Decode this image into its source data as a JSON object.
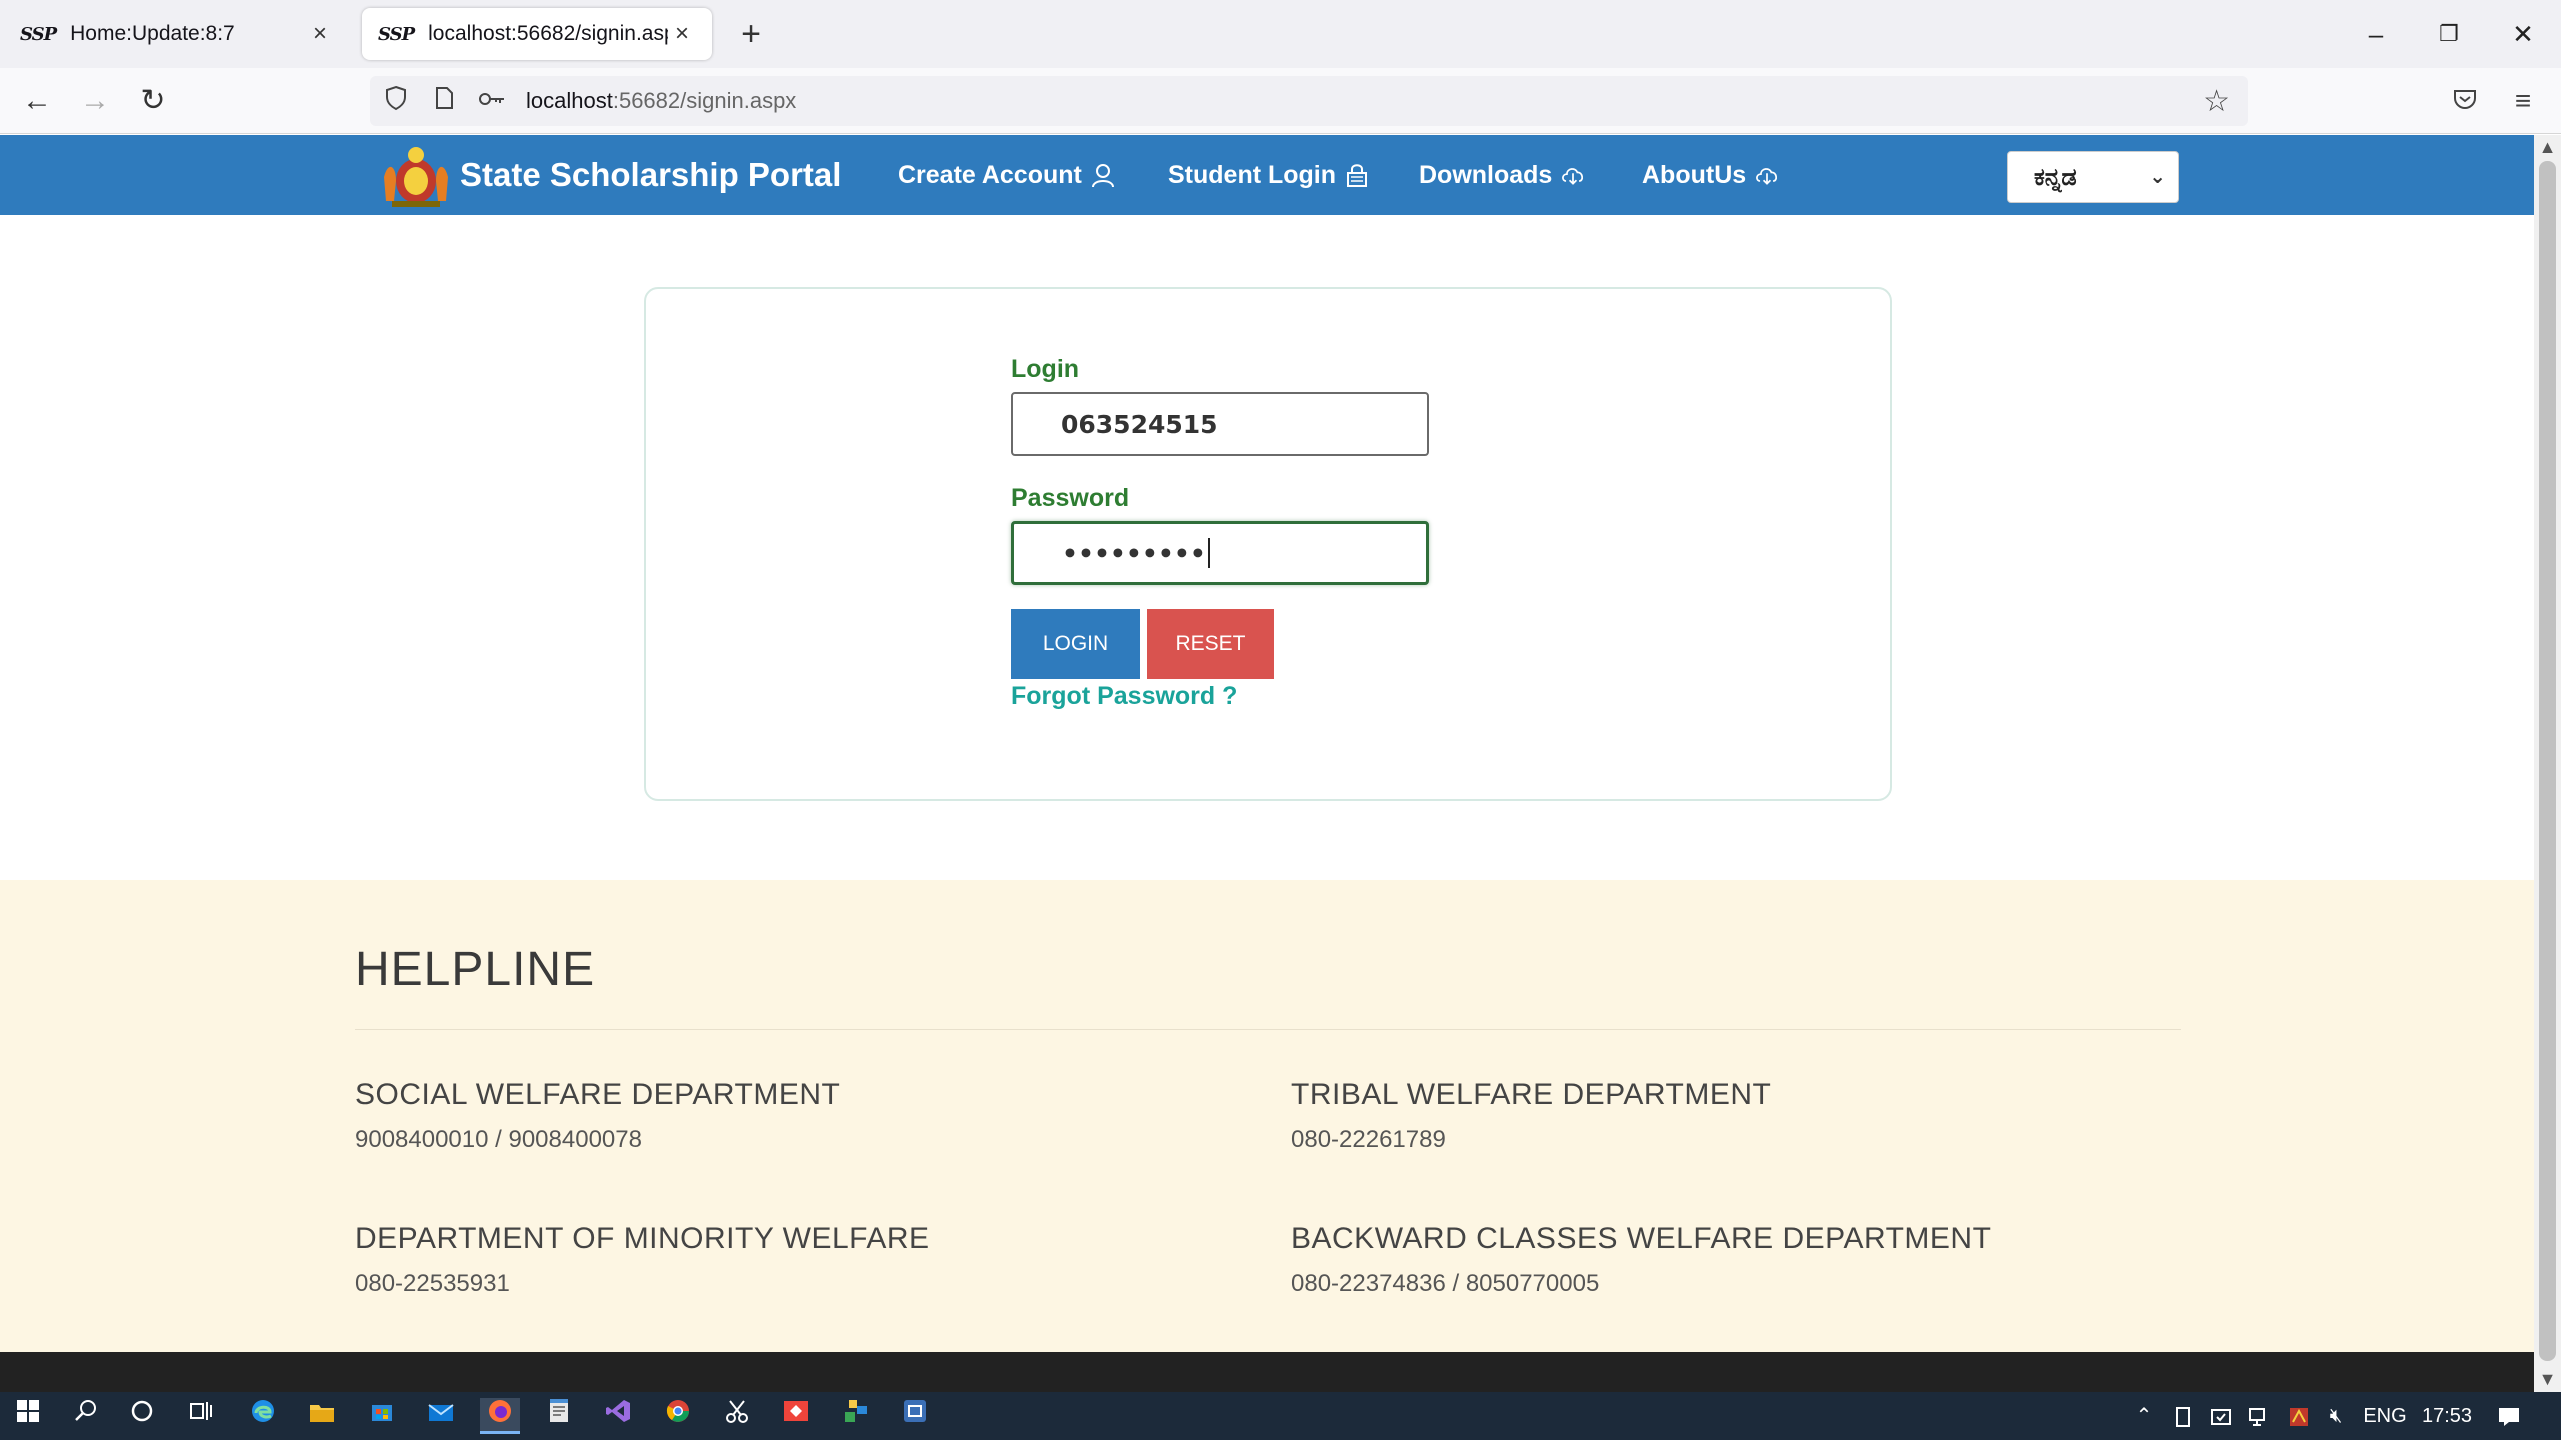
{
  "browser": {
    "tabs": [
      {
        "favicon": "SSP",
        "title": "Home:Update:8:7",
        "active": false
      },
      {
        "favicon": "SSP",
        "title": "localhost:56682/signin.aspx",
        "active": true
      }
    ],
    "url_host": "localhost",
    "url_path": ":56682/signin.aspx"
  },
  "header": {
    "brand": "State Scholarship Portal",
    "menu": [
      {
        "label": "Create Account",
        "icon": "user-icon"
      },
      {
        "label": "Student Login",
        "icon": "lock-icon"
      },
      {
        "label": "Downloads",
        "icon": "cloud-download-icon"
      },
      {
        "label": "AboutUs",
        "icon": "cloud-download-icon"
      }
    ],
    "language": "ಕನ್ನಡ"
  },
  "login": {
    "login_label": "Login",
    "login_value": "063524515",
    "password_label": "Password",
    "password_value": "•••••••••",
    "login_button": "LOGIN",
    "reset_button": "RESET",
    "forgot": "Forgot Password ?"
  },
  "helpline": {
    "title": "HELPLINE",
    "departments": [
      {
        "name": "SOCIAL WELFARE DEPARTMENT",
        "phone": "9008400010 / 9008400078"
      },
      {
        "name": "TRIBAL WELFARE DEPARTMENT",
        "phone": "080-22261789"
      },
      {
        "name": "DEPARTMENT OF MINORITY WELFARE",
        "phone": "080-22535931"
      },
      {
        "name": "BACKWARD CLASSES WELFARE DEPARTMENT",
        "phone": "080-22374836 / 8050770005"
      }
    ]
  },
  "taskbar": {
    "language": "ENG",
    "time": "17:53"
  },
  "colors": {
    "header_blue": "#2f7bbd",
    "label_green": "#2e7d32",
    "reset_red": "#d9534f",
    "forgot_teal": "#1aa39a",
    "helpline_bg": "#fdf6e3"
  }
}
